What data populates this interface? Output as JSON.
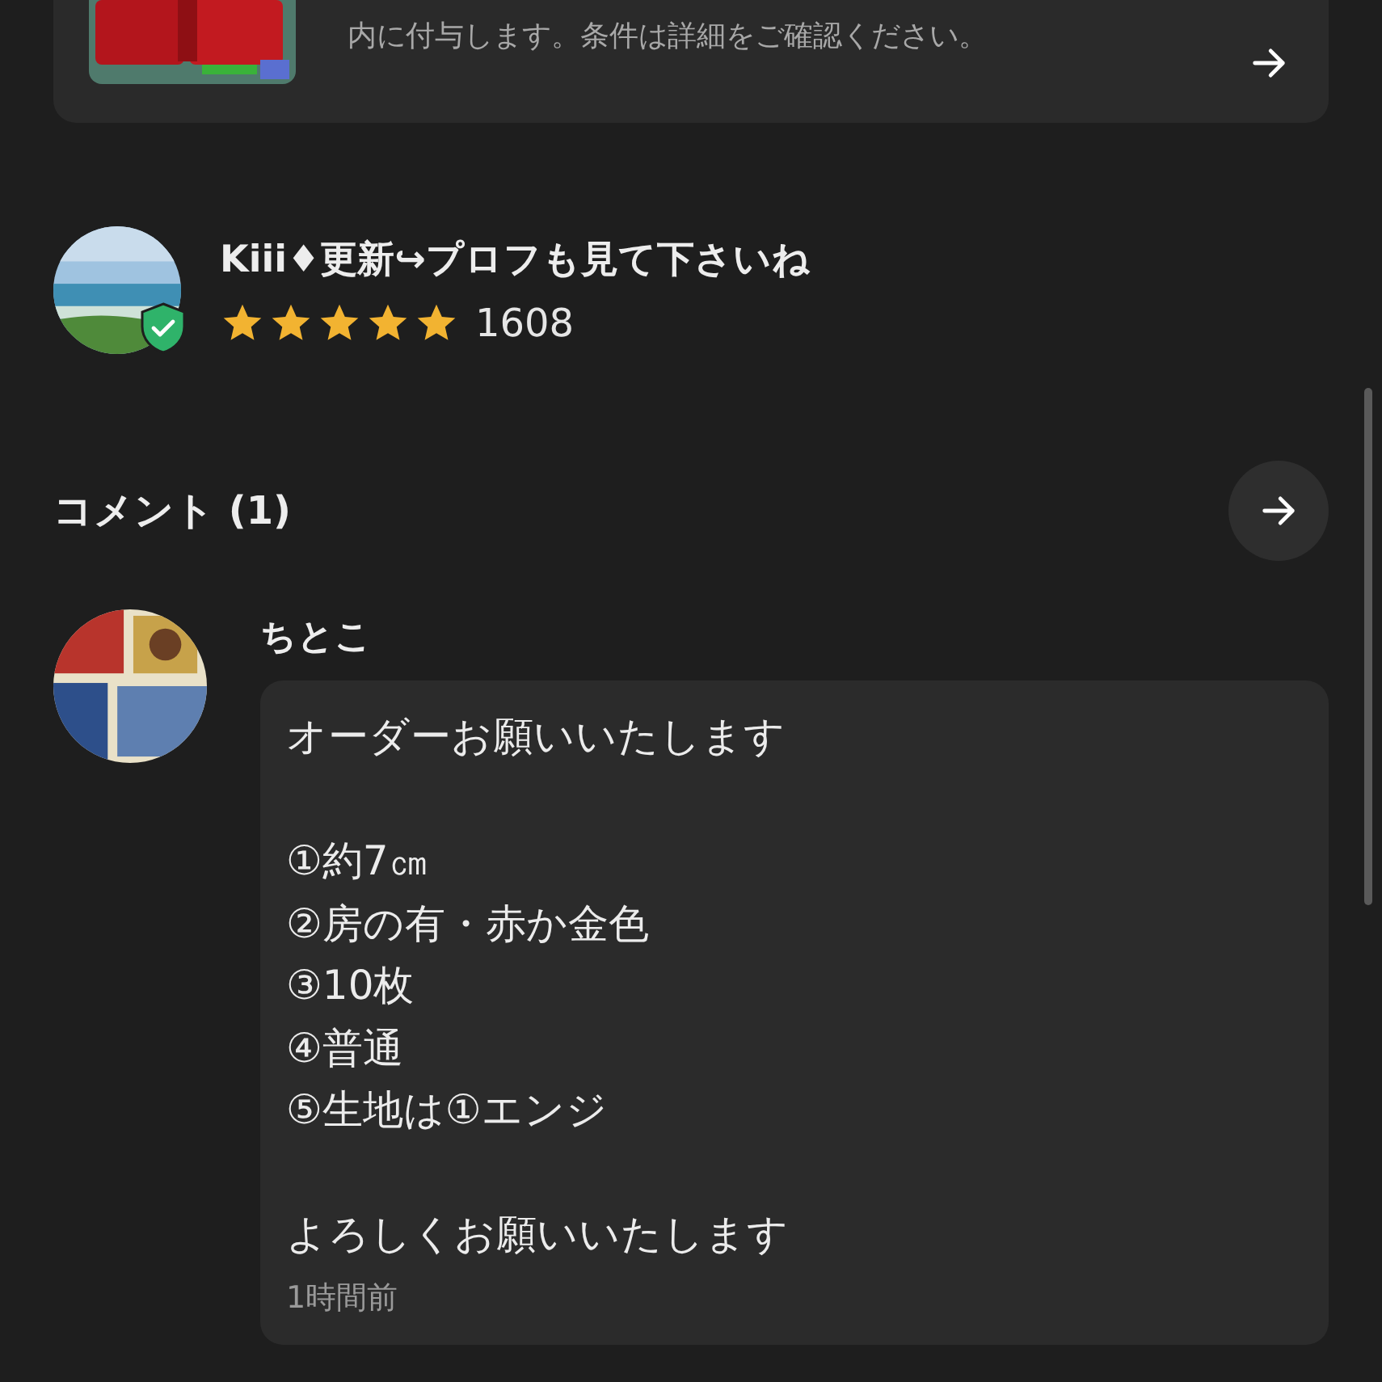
{
  "promo_card": {
    "text": "内に付与します。条件は詳細をご確認ください。"
  },
  "seller": {
    "name": "Kiii♦更新↪プロフも見て下さいね",
    "verified": true,
    "stars": 5,
    "rating_count": "1608"
  },
  "comments_section": {
    "title": "コメント (1)"
  },
  "comments": [
    {
      "author": "ちとこ",
      "paragraphs": [
        [
          "オーダーお願いいたします"
        ],
        [
          "①約7㎝",
          "②房の有・赤か金色",
          "③10枚",
          "④普通",
          "⑤生地は①エンジ"
        ],
        [
          "よろしくお願いいたします"
        ]
      ],
      "time": "1時間前"
    }
  ]
}
